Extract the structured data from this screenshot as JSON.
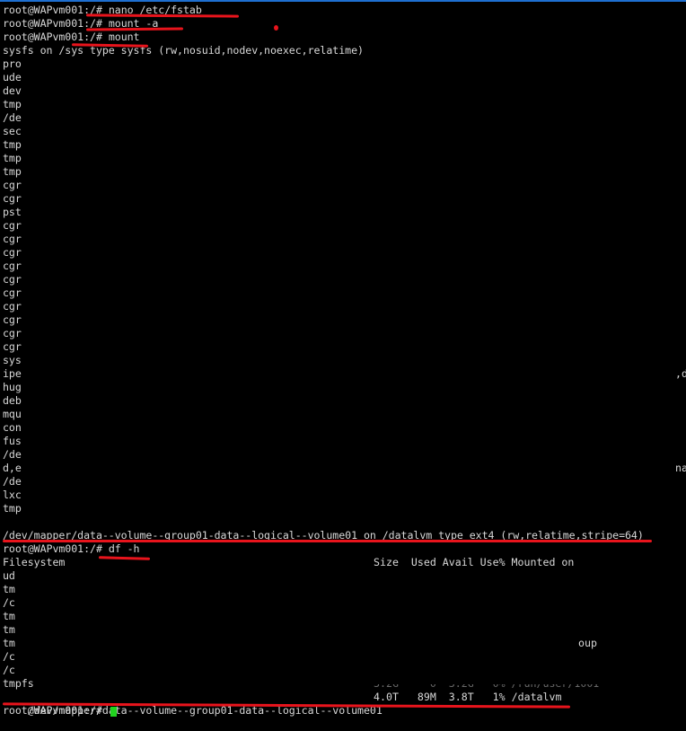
{
  "terminal": {
    "prompt": "root@WAPvm001:/#",
    "commands": [
      {
        "prompt": "root@WAPvm001:/#",
        "cmd": "nano /etc/fstab"
      },
      {
        "prompt": "root@WAPvm001:/#",
        "cmd": "mount -a"
      },
      {
        "prompt": "root@WAPvm001:/#",
        "cmd": "mount"
      }
    ],
    "mount_output_first": "sysfs on /sys type sysfs (rw,nosuid,nodev,noexec,relatime)",
    "mount_output_truncated": [
      "pro",
      "ude",
      "dev",
      "tmp",
      "/de",
      "sec",
      "tmp",
      "tmp",
      "tmp",
      "cgr",
      "cgr",
      "pst",
      "cgr",
      "cgr",
      "cgr",
      "cgr",
      "cgr",
      "cgr",
      "cgr",
      "cgr",
      "cgr",
      "cgr",
      "sys",
      "ipe",
      "hug",
      "deb",
      "mqu",
      "con",
      "fus",
      "/de",
      "d,e",
      "/de",
      "lxc",
      "tmp"
    ],
    "mount_right_fragments": {
      "sys": ",d",
      "fde": "na"
    },
    "mount_output_last": "/dev/mapper/data--volume--group01-data--logical--volume01 on /datalvm type ext4 (rw,relatime,stripe=64)",
    "df_command": {
      "prompt": "root@WAPvm001:/#",
      "cmd": "df -h"
    },
    "df_header": {
      "filesystem": "Filesystem",
      "rest": "Size  Used Avail Use% Mounted on"
    },
    "df_truncated_rows": [
      "ud",
      "tm",
      "/c",
      "tm",
      "tm",
      "tm",
      "/c",
      "/c",
      "tmpfs"
    ],
    "df_fragment_group": "oup",
    "df_partial_run_user": "3.2G     0  3.2G   0% /run/user/1001",
    "df_last_row": {
      "filesystem": "/dev/mapper/data--volume--group01-data--logical--volume01",
      "size": "4.0T",
      "used": "89M",
      "avail": "3.8T",
      "use_pct": "1%",
      "mounted_on": "/datalvm"
    },
    "final_prompt": "root@WAPvm001:/#"
  },
  "colors": {
    "background": "#000000",
    "text": "#d8d8d8",
    "annotation": "#e8141c",
    "cursor": "#21d21f",
    "top_accent": "#1e6fd0"
  }
}
